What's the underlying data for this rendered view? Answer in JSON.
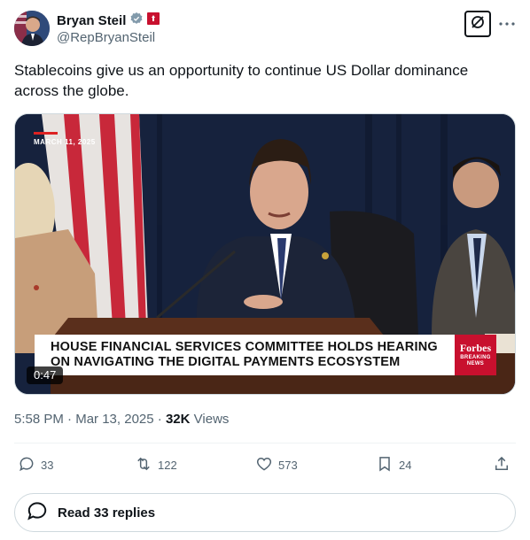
{
  "author": {
    "display_name": "Bryan Steil",
    "handle": "@RepBryanSteil"
  },
  "tweet": {
    "text": "Stablecoins give us an opportunity to continue US Dollar dominance across the globe."
  },
  "media": {
    "date_stamp": "MARCH 11, 2025",
    "headline_line1": "HOUSE FINANCIAL SERVICES COMMITTEE HOLDS HEARING",
    "headline_line2": "ON NAVIGATING THE DIGITAL PAYMENTS ECOSYSTEM",
    "brand": "Forbes",
    "brand_sub1": "BREAKING",
    "brand_sub2": "NEWS",
    "duration": "0:47"
  },
  "meta": {
    "time": "5:58 PM",
    "sep1": "·",
    "date": "Mar 13, 2025",
    "sep2": "·",
    "views_count": "32K",
    "views_label": "Views"
  },
  "actions": {
    "replies": "33",
    "reposts": "122",
    "likes": "573",
    "bookmarks": "24"
  },
  "read_replies": "Read 33 replies",
  "colors": {
    "text": "#0f1419",
    "secondary": "#536471",
    "verified": "#829aab",
    "forbes_red": "#c8102e"
  }
}
